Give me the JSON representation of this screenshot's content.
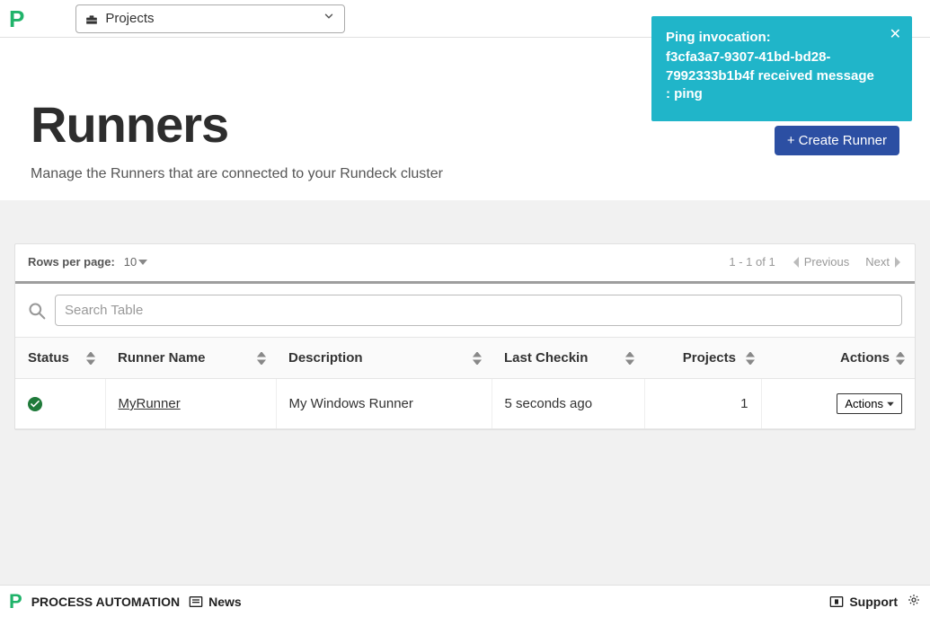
{
  "logo": "P",
  "project_selector": {
    "label": "Projects"
  },
  "toast": {
    "title": "Ping invocation:",
    "body": "f3cfa3a7-9307-41bd-bd28-7992333b1b4f received message : ping"
  },
  "page": {
    "title": "Runners",
    "subtitle": "Manage the Runners that are connected to your Rundeck cluster",
    "create_button": "Create Runner"
  },
  "table_toolbar": {
    "rows_per_page_label": "Rows per page:",
    "rows_per_page_value": "10",
    "range": "1 - 1 of 1",
    "prev": "Previous",
    "next": "Next",
    "search_placeholder": "Search Table"
  },
  "columns": {
    "status": "Status",
    "name": "Runner Name",
    "description": "Description",
    "checkin": "Last Checkin",
    "projects": "Projects",
    "actions": "Actions"
  },
  "rows": [
    {
      "status": "healthy",
      "name": "MyRunner",
      "description": "My Windows Runner",
      "checkin": "5 seconds ago",
      "projects": "1",
      "actions_label": "Actions"
    }
  ],
  "footer": {
    "brand": "PROCESS AUTOMATION",
    "news": "News",
    "support": "Support"
  }
}
